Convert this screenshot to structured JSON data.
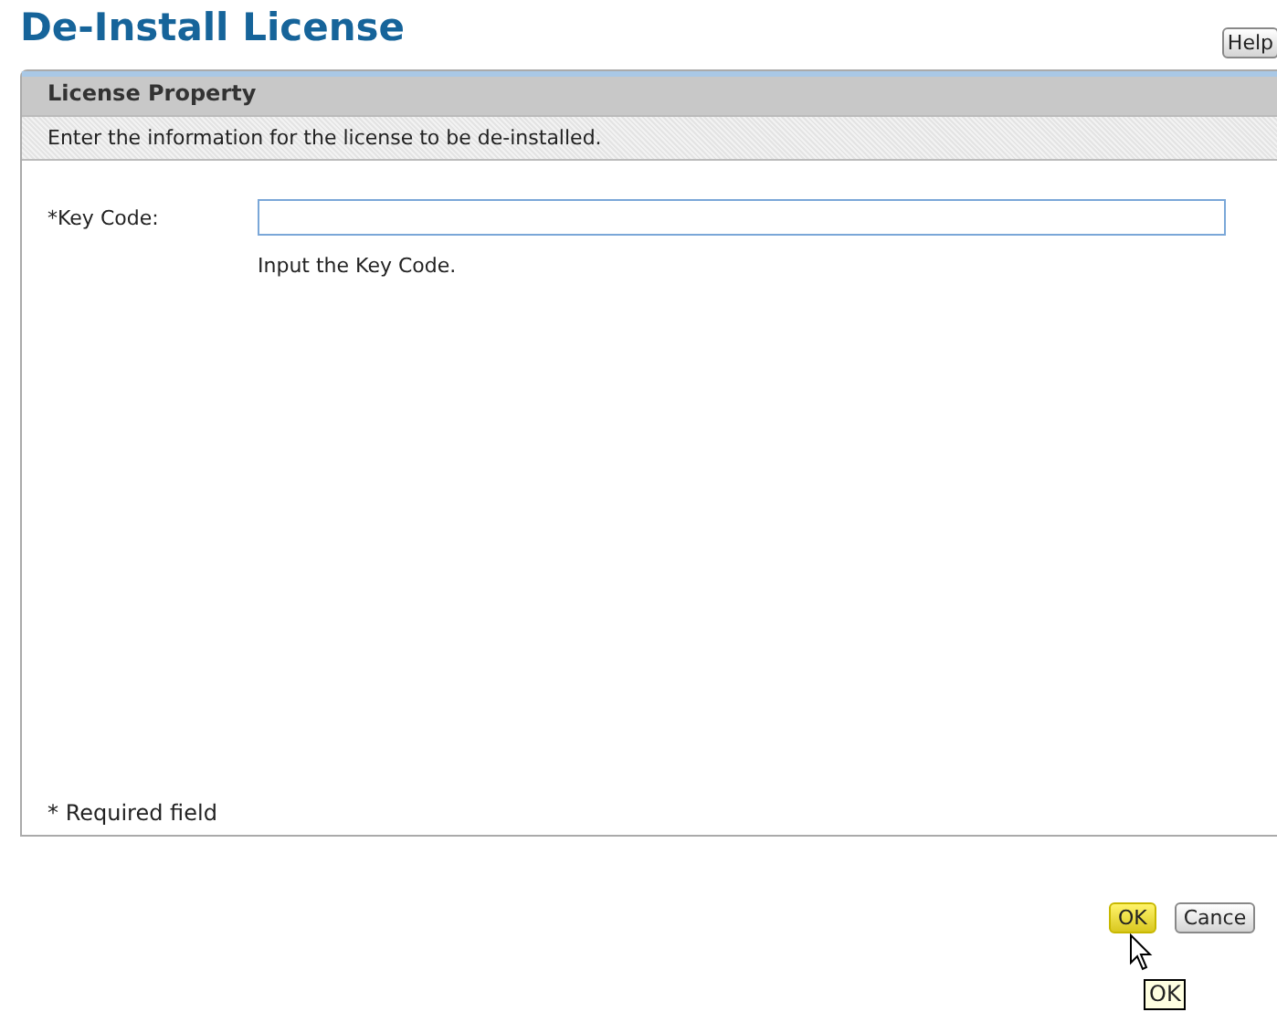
{
  "title": "De-Install License",
  "help_button": "Help",
  "panel": {
    "header": "License Property",
    "description": "Enter the information for the license to be de-installed.",
    "fields": [
      {
        "label": "*Key Code:",
        "hint": "Input the Key Code."
      }
    ],
    "footnote": "* Required field"
  },
  "buttons": [
    {
      "label": "OK",
      "hovered": true
    },
    {
      "label": "Cance",
      "hovered": false
    }
  ],
  "tooltip": "OK"
}
